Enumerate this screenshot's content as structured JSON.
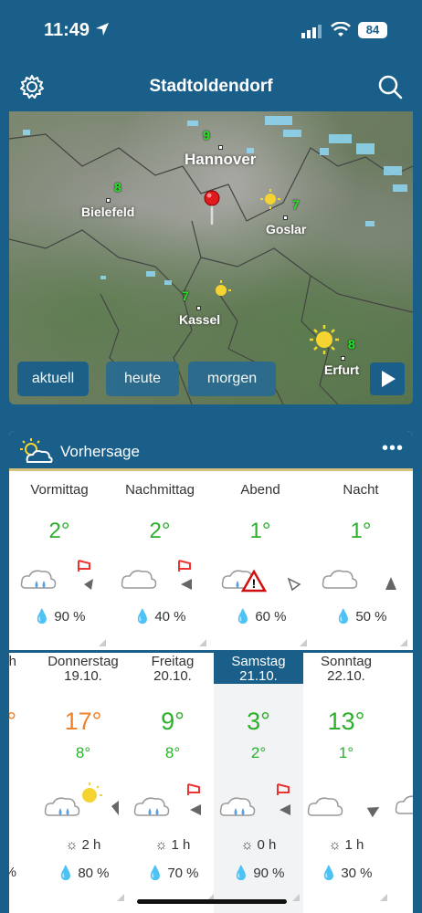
{
  "status": {
    "time": "11:49",
    "battery": "84"
  },
  "header": {
    "title": "Stadtoldendorf"
  },
  "map": {
    "cities": [
      {
        "name": "Hannover",
        "temp": "9"
      },
      {
        "name": "Bielefeld",
        "temp": "8"
      },
      {
        "name": "Goslar",
        "temp": "7"
      },
      {
        "name": "Kassel",
        "temp": "7"
      },
      {
        "name": "Erfurt",
        "temp": "8"
      }
    ],
    "buttons": [
      "aktuell",
      "heute",
      "morgen"
    ]
  },
  "forecast": {
    "title": "Vorhersage",
    "more": "•••",
    "parts": [
      {
        "name": "Vormittag",
        "temp": "2°",
        "rain": "90 %"
      },
      {
        "name": "Nachmittag",
        "temp": "2°",
        "rain": "40 %"
      },
      {
        "name": "Abend",
        "temp": "1°",
        "rain": "60 %"
      },
      {
        "name": "Nacht",
        "temp": "1°",
        "rain": "50 %"
      }
    ],
    "days": [
      {
        "day": "Donnerstag",
        "date": "19.10.",
        "max": "17°",
        "min": "8°",
        "sun": "2 h",
        "rain": "80 %",
        "maxColor": "#f0822a"
      },
      {
        "day": "Freitag",
        "date": "20.10.",
        "max": "9°",
        "min": "8°",
        "sun": "1 h",
        "rain": "70 %",
        "maxColor": "#2bb02b"
      },
      {
        "day": "Samstag",
        "date": "21.10.",
        "max": "3°",
        "min": "2°",
        "sun": "0 h",
        "rain": "90 %",
        "maxColor": "#2bb02b"
      },
      {
        "day": "Sonntag",
        "date": "22.10.",
        "max": "13°",
        "min": "1°",
        "sun": "1 h",
        "rain": "30 %",
        "maxColor": "#2bb02b"
      }
    ],
    "partial_left": {
      "head": "ch",
      "rain": "%"
    }
  },
  "colors": {
    "brand": "#1a5f8a",
    "warm": "#f0822a",
    "cool": "#2bb02b"
  }
}
